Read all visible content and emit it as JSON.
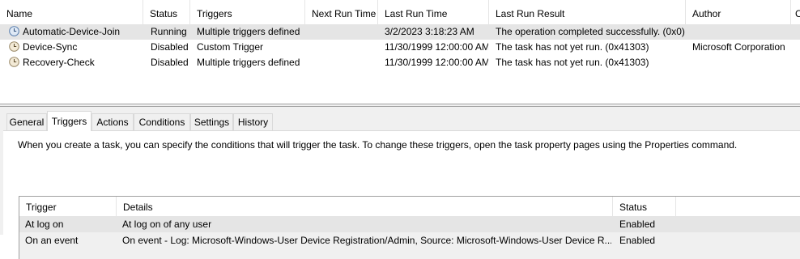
{
  "task_list": {
    "columns": [
      "Name",
      "Status",
      "Triggers",
      "Next Run Time",
      "Last Run Time",
      "Last Run Result",
      "Author",
      "C"
    ],
    "rows": [
      {
        "name": "Automatic-Device-Join",
        "status": "Running",
        "triggers": "Multiple triggers defined",
        "next_run": "",
        "last_run": "3/2/2023 3:18:23 AM",
        "result": "The operation completed successfully. (0x0)",
        "author": "",
        "selected": true
      },
      {
        "name": "Device-Sync",
        "status": "Disabled",
        "triggers": "Custom Trigger",
        "next_run": "",
        "last_run": "11/30/1999 12:00:00 AM",
        "result": "The task has not yet run. (0x41303)",
        "author": "Microsoft Corporation",
        "selected": false
      },
      {
        "name": "Recovery-Check",
        "status": "Disabled",
        "triggers": "Multiple triggers defined",
        "next_run": "",
        "last_run": "11/30/1999 12:00:00 AM",
        "result": "The task has not yet run. (0x41303)",
        "author": "",
        "selected": false
      }
    ]
  },
  "tabs": [
    "General",
    "Triggers",
    "Actions",
    "Conditions",
    "Settings",
    "History"
  ],
  "active_tab": "Triggers",
  "triggers_tab": {
    "description": "When you create a task, you can specify the conditions that will trigger the task.  To change these triggers, open the task property pages using the Properties command.",
    "columns": [
      "Trigger",
      "Details",
      "Status"
    ],
    "rows": [
      {
        "trigger": "At log on",
        "details": "At log on of any user",
        "status": "Enabled"
      },
      {
        "trigger": "On an event",
        "details": "On event - Log: Microsoft-Windows-User Device Registration/Admin, Source: Microsoft-Windows-User Device R...",
        "status": "Enabled"
      }
    ]
  },
  "icons": {
    "task": "clock-icon"
  },
  "colors": {
    "selected_row": "#e5e5e5",
    "pane_bg": "#f0f0f0",
    "border": "#a0a0a0"
  }
}
